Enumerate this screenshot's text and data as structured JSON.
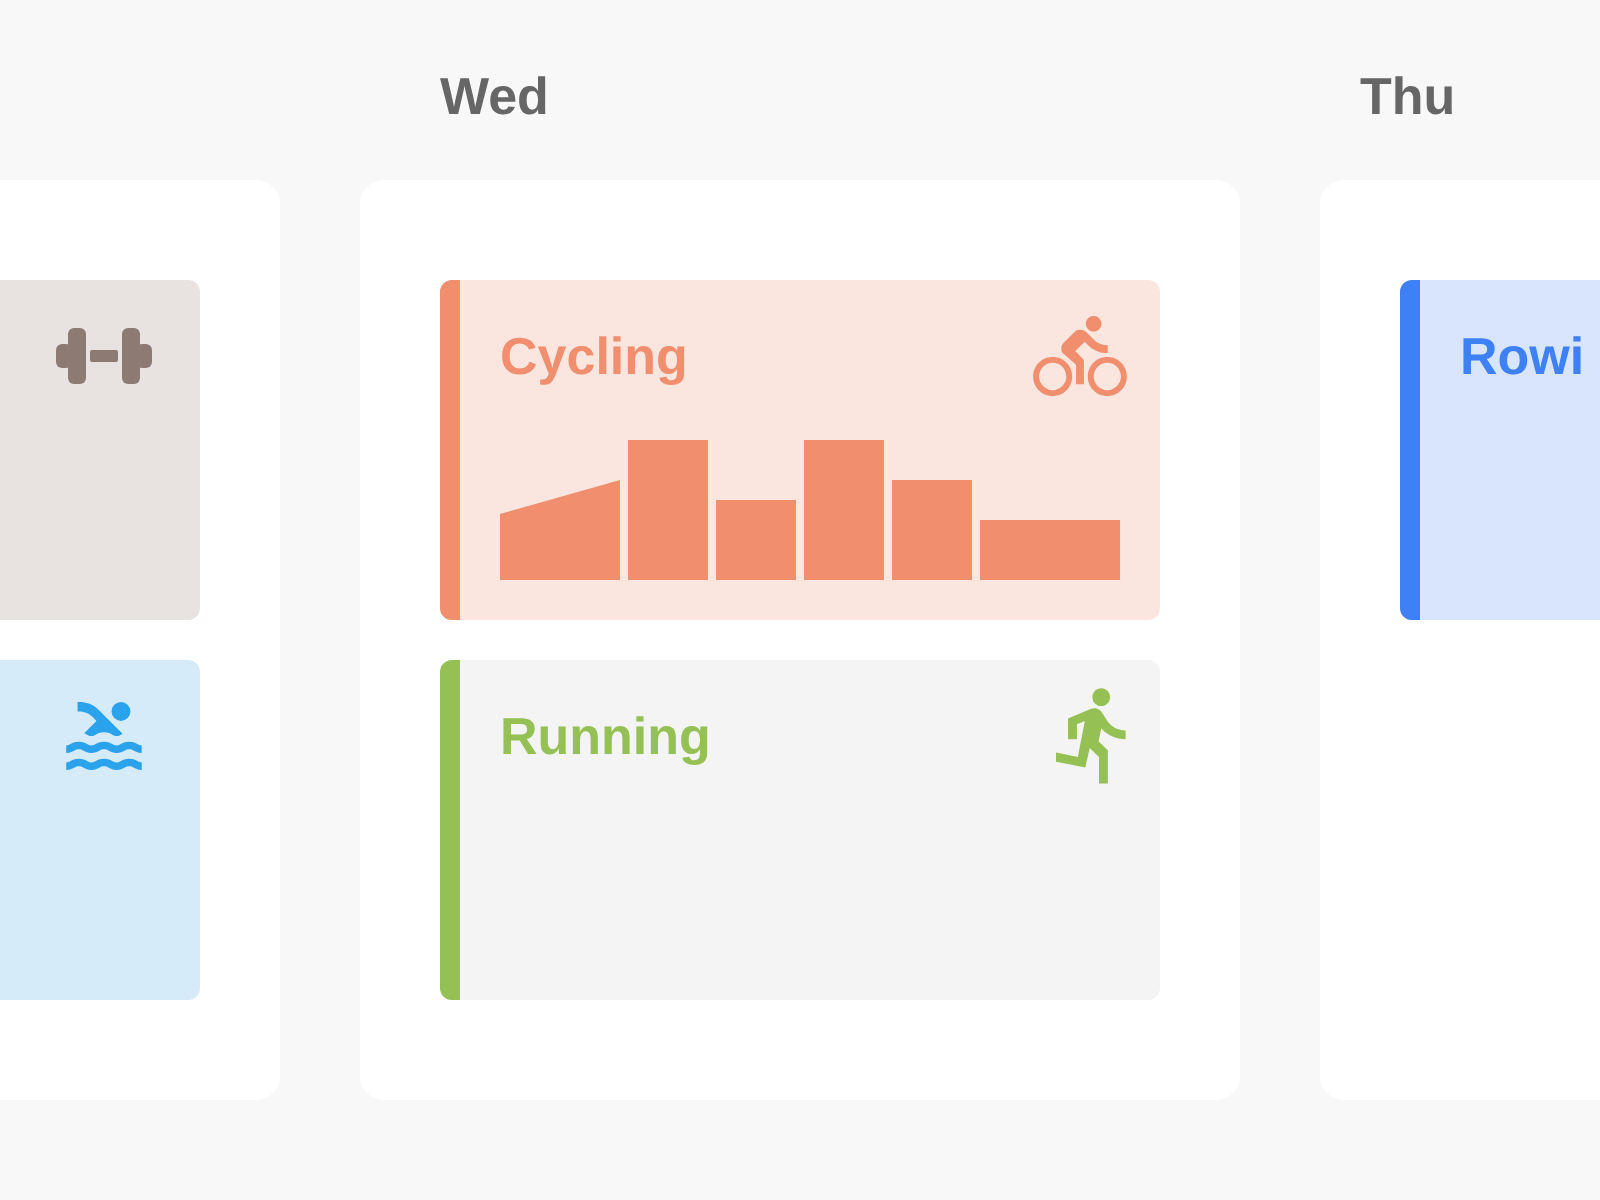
{
  "columns": [
    {
      "cards": [
        {
          "kind": "strength",
          "color": "#8d7b73",
          "has_chart": false
        },
        {
          "kind": "swimming",
          "color": "#2ba3ec",
          "has_chart": false
        }
      ]
    },
    {
      "day": "Wed",
      "cards": [
        {
          "kind": "cycling",
          "title": "Cycling",
          "color": "#f08e6d",
          "has_chart": true
        },
        {
          "kind": "running",
          "title": "Running",
          "color": "#94c054",
          "has_chart": false
        }
      ]
    },
    {
      "day": "Thu",
      "cards": [
        {
          "kind": "rowing",
          "title": "Rowi",
          "color": "#3e80f5",
          "has_chart": false
        }
      ]
    }
  ]
}
